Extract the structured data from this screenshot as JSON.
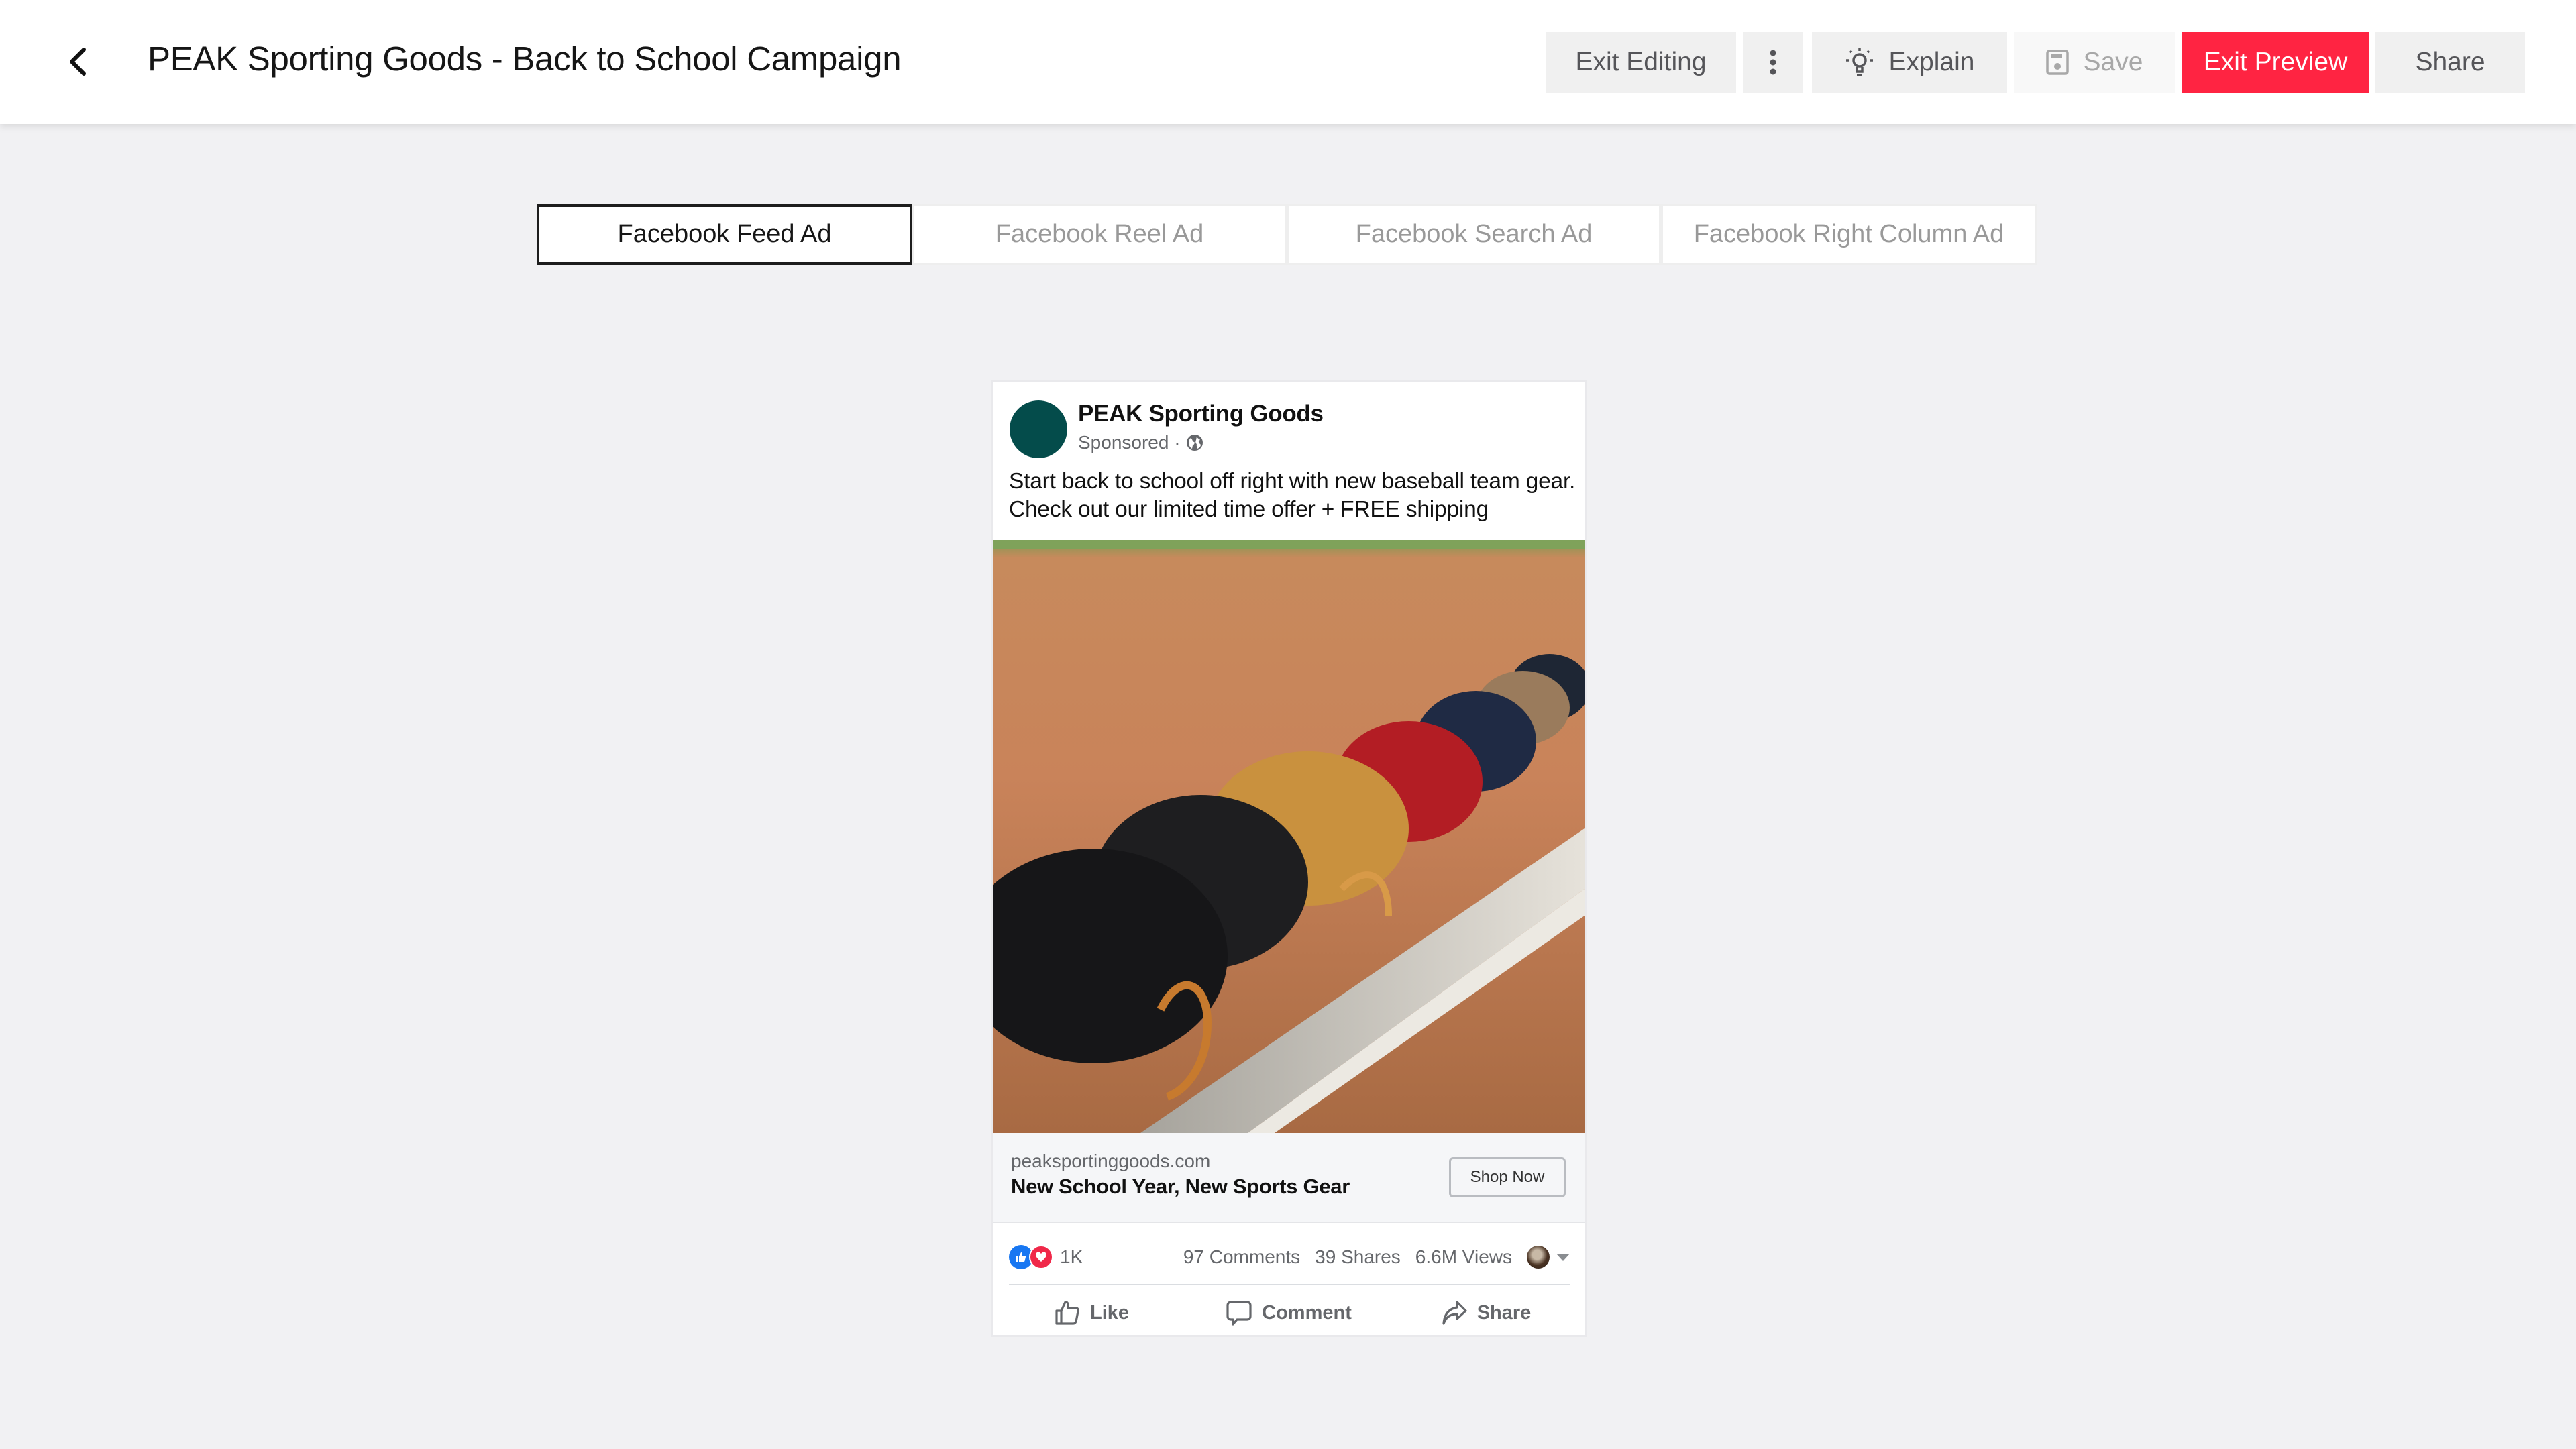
{
  "header": {
    "title": "PEAK Sporting Goods - Back to School Campaign",
    "back_icon": "chevron-left-icon",
    "buttons": {
      "exit_editing": "Exit Editing",
      "more_icon": "vertical-dots-icon",
      "explain": "Explain",
      "explain_icon": "lightbulb-icon",
      "save": "Save",
      "save_icon": "floppy-disk-icon",
      "exit_preview": "Exit Preview",
      "share": "Share"
    },
    "colors": {
      "accent": "#ff2442",
      "button_bg": "#f0f0f0"
    }
  },
  "tabs": [
    {
      "label": "Facebook Feed Ad",
      "active": true
    },
    {
      "label": "Facebook Reel Ad",
      "active": false
    },
    {
      "label": "Facebook Search Ad",
      "active": false
    },
    {
      "label": "Facebook Right Column Ad",
      "active": false
    }
  ],
  "ad": {
    "page_name": "PEAK Sporting Goods",
    "sponsored": "Sponsored ·",
    "avatar_color": "#044c4b",
    "caption": "Start back to school off right with new baseball team gear. Check out our limited time offer + FREE shipping",
    "image_alt": "Row of baseball gloves on a bench at a baseball field",
    "link": {
      "domain": "peaksportinggoods.com",
      "headline": "New School Year, New Sports Gear",
      "cta": "Shop Now"
    },
    "stats": {
      "reactions": "1K",
      "comments": "97 Comments",
      "shares": "39 Shares",
      "views": "6.6M Views"
    },
    "actions": {
      "like": "Like",
      "comment": "Comment",
      "share": "Share"
    }
  }
}
